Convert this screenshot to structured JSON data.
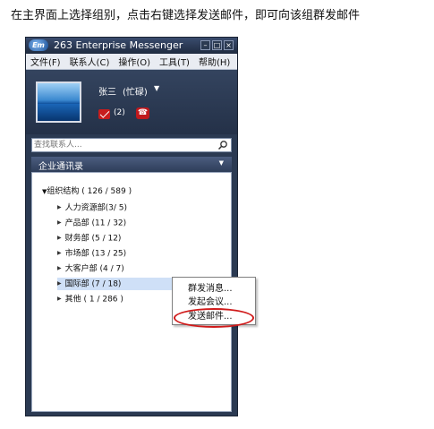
{
  "caption": "在主界面上选择组别，点击右键选择发送邮件，即可向该组群发邮件",
  "window": {
    "title": "263 Enterprise Messenger",
    "logo_text": "Em",
    "menu": [
      "文件(F)",
      "联系人(C)",
      "操作(O)",
      "工具(T)",
      "帮助(H)"
    ]
  },
  "profile": {
    "name": "张三",
    "status": "(忙碌)",
    "mail_count": "(2)"
  },
  "search": {
    "placeholder": "查找联系人..."
  },
  "panel": {
    "title": "企业通讯录"
  },
  "tree": {
    "root": "组织结构 ( 126 / 589 )",
    "children": [
      "人力资源部(3/ 5)",
      "产品部 (11 / 32)",
      "财务部 (5 / 12)",
      "市场部 (13 / 25)",
      "大客户部 (4 / 7)",
      "国际部 (7 / 18)",
      "其他 ( 1 / 286 )"
    ]
  },
  "context_menu": [
    "群发消息...",
    "发起会议...",
    "发送邮件..."
  ]
}
